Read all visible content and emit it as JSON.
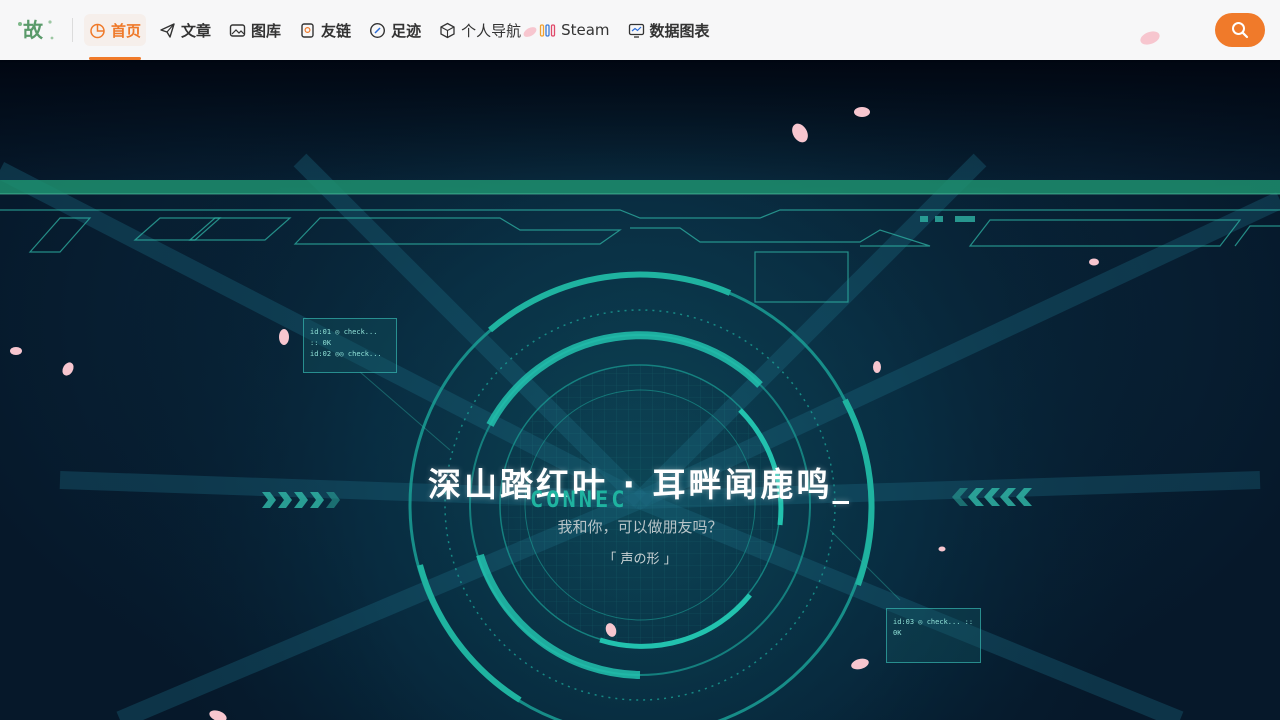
{
  "header": {
    "logo_text": "故",
    "nav": [
      {
        "label": "首页",
        "icon": "pie-chart-icon",
        "active": true
      },
      {
        "label": "文章",
        "icon": "paper-plane-icon",
        "active": false
      },
      {
        "label": "图库",
        "icon": "image-icon",
        "active": false
      },
      {
        "label": "友链",
        "icon": "bookmark-icon",
        "active": false
      },
      {
        "label": "足迹",
        "icon": "compass-icon",
        "active": false
      },
      {
        "label": "个人导航",
        "icon": "cube-icon",
        "active": false
      },
      {
        "label": "Steam",
        "icon": "steam-bars-icon",
        "active": false
      },
      {
        "label": "数据图表",
        "icon": "monitor-chart-icon",
        "active": false
      }
    ],
    "search_icon": "search-icon"
  },
  "hero": {
    "title": "深山踏红叶 · 耳畔闻鹿鸣",
    "cursor": "_",
    "connect": "CONNEC",
    "subtitle": "我和你，可以做朋友吗？",
    "quote": "「 声の形 」",
    "panel_left_lines": [
      "id:01 ◎ check... :: 0K",
      "id:02 ◎◎ check..."
    ],
    "panel_right_lines": [
      "id:03 ◎ check... :: 0K"
    ]
  },
  "colors": {
    "accent": "#f07a2a",
    "hud": "#1fb3a0",
    "petal": "#f7c6cf"
  }
}
